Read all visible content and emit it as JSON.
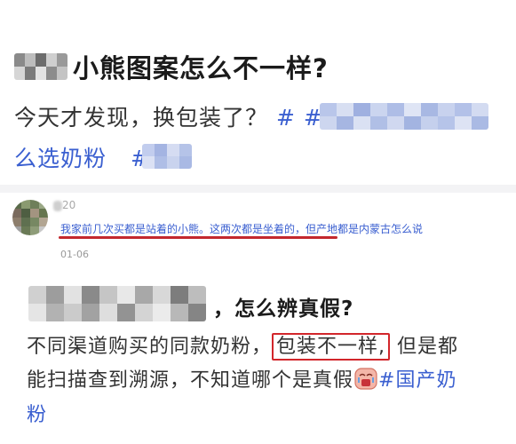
{
  "post1": {
    "title": "小熊图案怎么不一样?",
    "line1_text": "今天才发现，换包装了？",
    "line1_tag_start": "# #",
    "line2_tag_end": "么选奶粉",
    "line2_tag_prefix": "#"
  },
  "comment": {
    "username": "20",
    "text": "我家前几次买都是站着的小熊。这两次都是坐着的，但产地都是内蒙古怎么说",
    "date": "01-06"
  },
  "post2": {
    "title": "，怎么辨真假?",
    "line1_before": "不同渠道购买的同款奶粉，",
    "line1_boxed": "包装不一样,",
    "line1_after": " 但是都",
    "line2_text": "能扫描查到溯源，不知道哪个是真假",
    "line2_tag": "#国产奶",
    "line3_tag": "粉"
  },
  "colors": {
    "tag_blue": "#3a5fd0",
    "highlight_red": "#d2262b"
  }
}
